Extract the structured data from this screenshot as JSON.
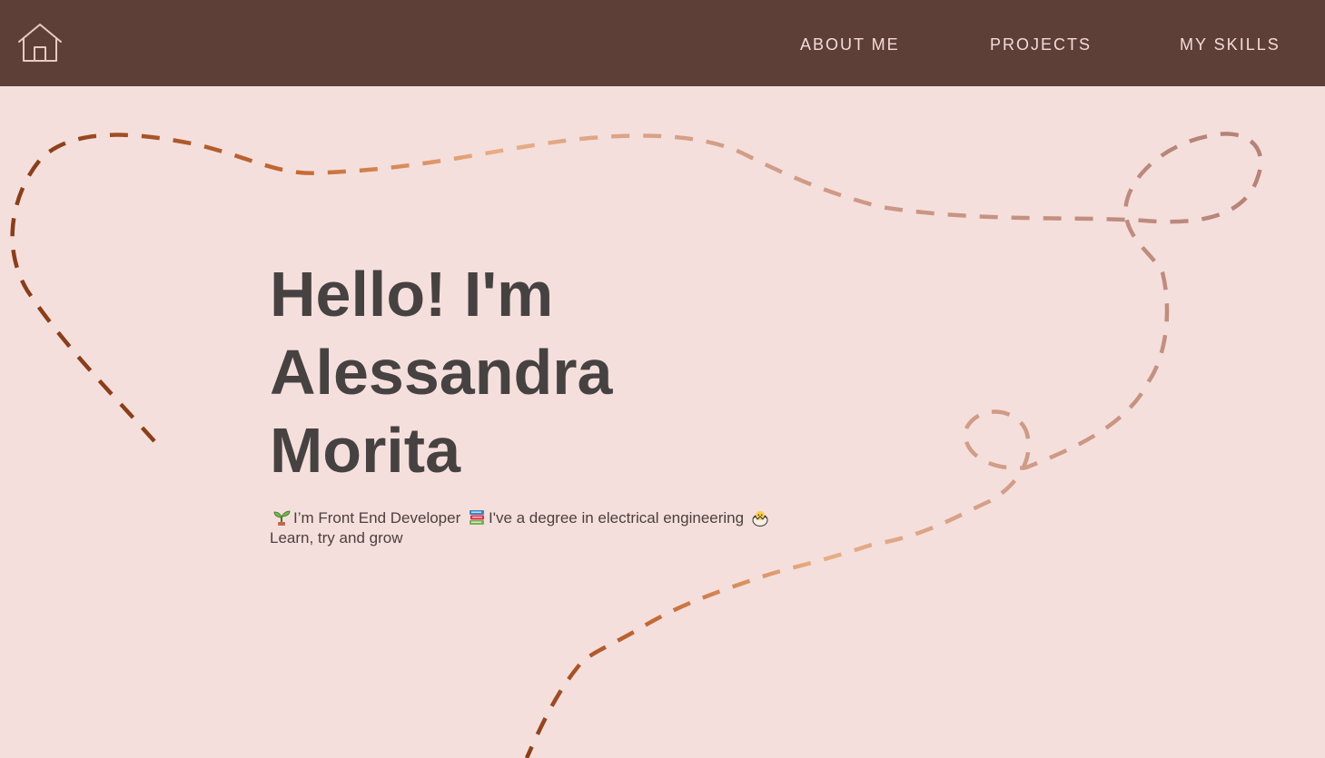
{
  "nav": {
    "home_icon": "home-icon",
    "items": [
      {
        "label": "ABOUT ME"
      },
      {
        "label": "PROJECTS"
      },
      {
        "label": "MY SKILLS"
      }
    ]
  },
  "hero": {
    "title_lines": [
      "Hello! I'm",
      "Alessandra",
      "Morita"
    ],
    "bio": [
      {
        "icon": "seedling-icon",
        "text": "I’m Front End Developer"
      },
      {
        "icon": "books-icon",
        "text": "I've a degree in electrical engineering"
      },
      {
        "icon": "hatching-chick-icon",
        "text": "Learn, try and grow"
      }
    ]
  },
  "colors": {
    "navbar": "#5e3f38",
    "background": "#f5dfdc",
    "nav_text": "#f3dcd7",
    "title": "#464241",
    "path_start": "#b58379",
    "path_mid": "#e8ad85",
    "path_end": "#8a3e1a"
  }
}
